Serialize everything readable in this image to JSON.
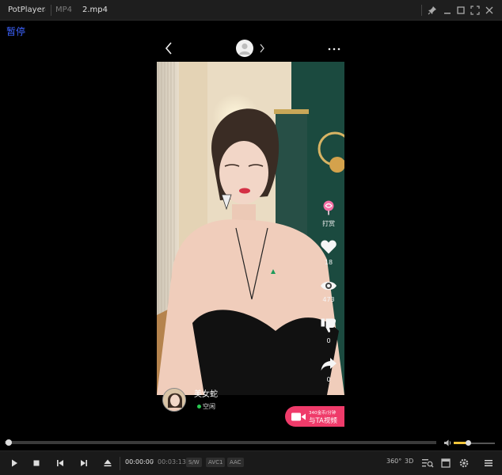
{
  "titlebar": {
    "app_name": "PotPlayer",
    "format_tab": "MP4",
    "file_tab": "2.mp4",
    "icons": [
      "pin-icon",
      "minimize-icon",
      "restore-icon",
      "fullscreen-icon",
      "close-icon"
    ]
  },
  "osd": {
    "text": "暂停"
  },
  "video": {
    "actions": [
      {
        "icon": "lollipop-icon",
        "label": "打赏"
      },
      {
        "icon": "heart-icon",
        "label": "18"
      },
      {
        "icon": "eye-icon",
        "label": "473"
      },
      {
        "icon": "thumbs-down-icon",
        "label": "0"
      },
      {
        "icon": "share-icon",
        "label": "0"
      }
    ],
    "user_name": "美女蛇",
    "status": "空闲",
    "call_button": {
      "line1": "340金币/分钟",
      "line2": "与TA视频"
    },
    "colors": {
      "call_button": "#ef3b6a",
      "status_dot": "#28c850"
    }
  },
  "player": {
    "seek_progress": 0.01,
    "volume_level": 0.35,
    "time_current": "00:00:00",
    "time_separator": "/",
    "time_total": "00:03:13",
    "badges": [
      "S/W",
      "AVC1",
      "AAC"
    ],
    "label_360": "360°",
    "label_3d": "3D",
    "colors": {
      "volume": "#f0c43a",
      "osd": "#3d63ff"
    }
  }
}
